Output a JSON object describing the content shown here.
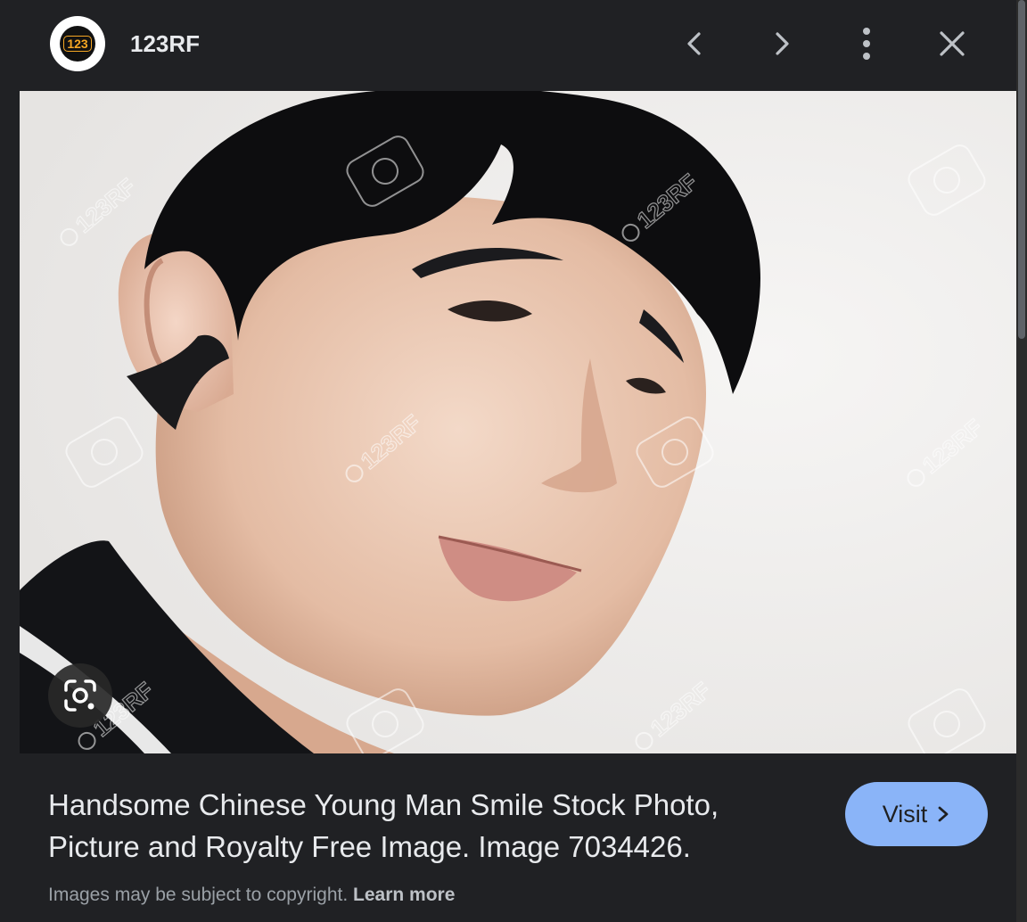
{
  "header": {
    "source_logo_text": "123",
    "source_name": "123RF",
    "icons": {
      "prev": "chevron-left-icon",
      "next": "chevron-right-icon",
      "more": "more-vert-icon",
      "close": "close-icon"
    }
  },
  "image": {
    "watermark_text": "123RF",
    "lens_icon": "google-lens-icon"
  },
  "footer": {
    "title": "Handsome Chinese Young Man Smile Stock Photo, Picture and Royalty Free Image. Image 7034426.",
    "visit_label": "Visit",
    "copyright_text": "Images may be subject to copyright.",
    "learn_more_label": "Learn more"
  },
  "colors": {
    "panel_background": "#202124",
    "visit_button": "#8ab4f8",
    "text_primary": "#e8eaed",
    "text_secondary": "#9aa0a6",
    "logo_accent": "#f5a623"
  }
}
